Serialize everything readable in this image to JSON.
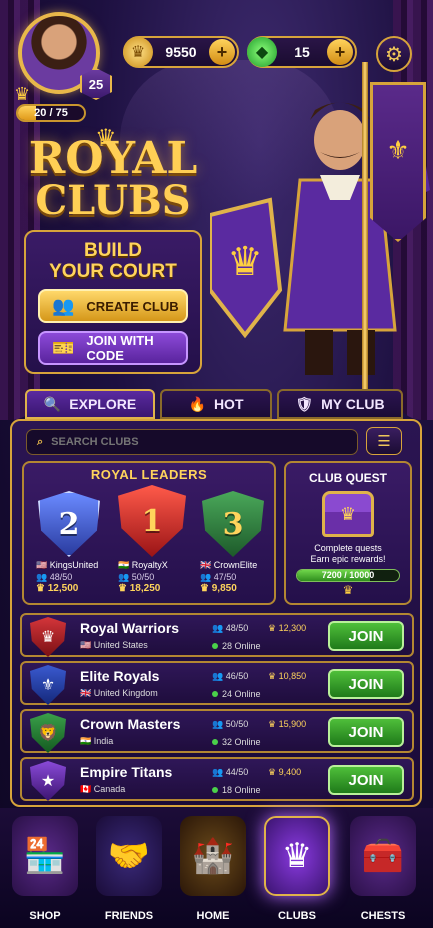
{
  "player": {
    "level": "25",
    "xp_text": "20 / 75",
    "xp_fraction": 0.27
  },
  "currency": {
    "coins": "9550",
    "gems": "15"
  },
  "hero": {
    "title_line1": "ROYAL",
    "title_line2": "CLUBS"
  },
  "build": {
    "title_line1": "BUILD",
    "title_line2": "YOUR COURT",
    "create_label": "CREATE CLUB",
    "join_code_label": "JOIN WITH CODE"
  },
  "tabs": [
    {
      "label": "EXPLORE",
      "icon": "magnifier-icon",
      "active": true
    },
    {
      "label": "HOT",
      "icon": "flame-icon",
      "active": false
    },
    {
      "label": "MY CLUB",
      "icon": "crest-icon",
      "active": false
    }
  ],
  "search": {
    "placeholder": "SEARCH CLUBS"
  },
  "leaders": {
    "title": "ROYAL LEADERS",
    "items": [
      {
        "rank": "2",
        "name": "KingsUnited",
        "members": "48/50",
        "points": "12,500",
        "color": "#3b5fc8",
        "flag": "us"
      },
      {
        "rank": "1",
        "name": "RoyaltyX",
        "members": "50/50",
        "points": "18,250",
        "color": "#c8282a",
        "flag": "in"
      },
      {
        "rank": "3",
        "name": "CrownElite",
        "members": "47/50",
        "points": "9,850",
        "color": "#2a7a3a",
        "flag": "uk"
      }
    ]
  },
  "quest": {
    "title": "CLUB QUEST",
    "desc_line1": "Complete quests",
    "desc_line2": "Earn epic rewards!",
    "progress_text": "7200 / 10000",
    "progress_fraction": 0.72
  },
  "clubs": [
    {
      "name": "Royal Warriors",
      "country": "United States",
      "members": "48/50",
      "points": "12,300",
      "online": "28 Online",
      "join": "JOIN",
      "emblem_color": "#b3242a",
      "flag": "us"
    },
    {
      "name": "Elite Royals",
      "country": "United Kingdom",
      "members": "46/50",
      "points": "10,850",
      "online": "24 Online",
      "join": "JOIN",
      "emblem_color": "#2a49a8",
      "flag": "uk"
    },
    {
      "name": "Crown Masters",
      "country": "India",
      "members": "50/50",
      "points": "15,900",
      "online": "32 Online",
      "join": "JOIN",
      "emblem_color": "#2a7a3a",
      "flag": "in"
    },
    {
      "name": "Empire Titans",
      "country": "Canada",
      "members": "44/50",
      "points": "9,400",
      "online": "18 Online",
      "join": "JOIN",
      "emblem_color": "#6a2fa8",
      "flag": "ca"
    }
  ],
  "nav": [
    {
      "label": "SHOP",
      "active": false
    },
    {
      "label": "FRIENDS",
      "active": false
    },
    {
      "label": "HOME",
      "active": false
    },
    {
      "label": "CLUBS",
      "active": true
    },
    {
      "label": "CHESTS",
      "active": false
    }
  ],
  "colors": {
    "gold": "#d7a43b",
    "purple": "#3a1b66",
    "green": "#2f8e1e"
  }
}
